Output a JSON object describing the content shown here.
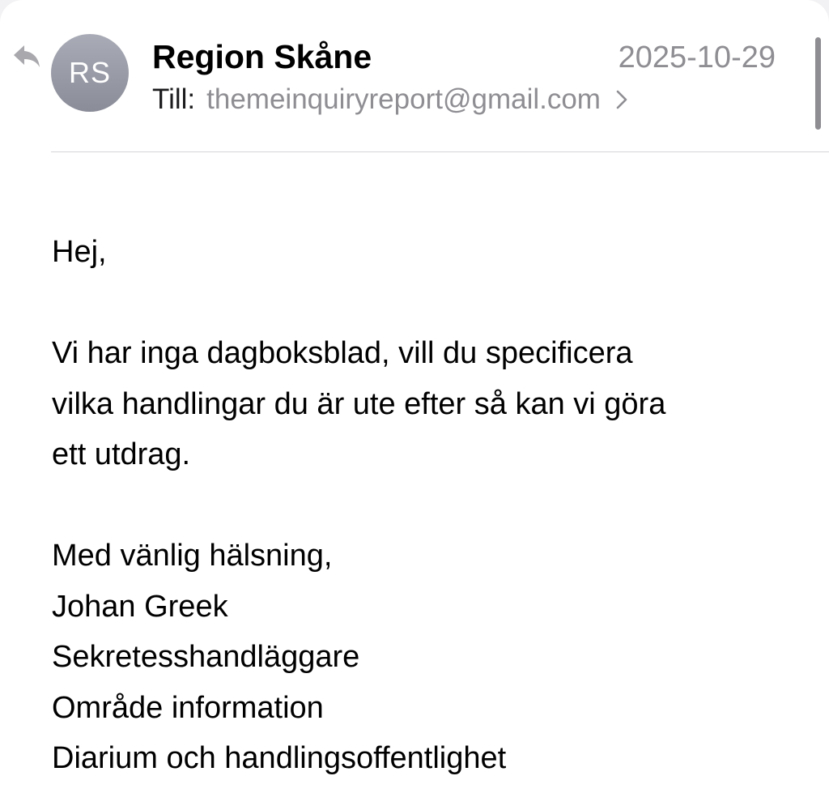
{
  "header": {
    "avatar_initials": "RS",
    "sender_name": "Region Skåne",
    "date": "2025-10-29",
    "to_label": "Till:",
    "to_address": "themeinquiryreport@gmail.com",
    "reply_icon": "reply-arrow-icon",
    "chevron_icon": "chevron-right-icon"
  },
  "body": {
    "greeting": "Hej,",
    "message_lines": [
      "Vi har inga dagboksblad, vill du specificera",
      "vilka handlingar du är ute efter så kan vi göra",
      "ett utdrag."
    ],
    "signature_lines": [
      "Med vänlig hälsning,",
      "Johan Greek",
      "Sekretesshandläggare",
      "Område information",
      "Diarium och handlingsoffentlighet"
    ]
  },
  "colors": {
    "background": "#ffffff",
    "secondary_text": "#8e8e93",
    "avatar": "#9a9ca7",
    "divider": "#d6d6da"
  }
}
